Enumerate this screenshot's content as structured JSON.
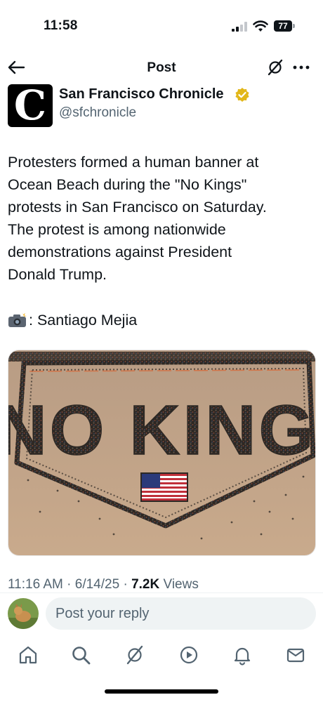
{
  "status_bar": {
    "time": "11:58",
    "battery": "77"
  },
  "header": {
    "title": "Post"
  },
  "author": {
    "logo_letter": "C",
    "name": "San Francisco Chronicle",
    "handle": "@sfchronicle",
    "verified_color": "#e2b719"
  },
  "post": {
    "text": "Protesters formed a human banner at\nOcean Beach during the \"No Kings\"\nprotests in San Francisco on Saturday.\nThe protest is among nationwide\ndemonstrations against President\nDonald Trump.",
    "credit_icon": "camera-flash-icon",
    "credit": ": Santiago Mejia",
    "image": {
      "sign_text": "NO KING!",
      "description_colors": {
        "sand": "#c4a58a",
        "crowd": "#2a2622",
        "flag_red": "#c0303a",
        "flag_blue": "#2b3a7a"
      }
    },
    "time": "11:16 AM",
    "date": "6/14/25",
    "views_count": "7.2K",
    "views_label": "Views"
  },
  "reply": {
    "placeholder": "Post your reply"
  },
  "nav": [
    "home-icon",
    "search-icon",
    "grok-icon",
    "video-icon",
    "notifications-icon",
    "messages-icon"
  ],
  "accent": "#0f1419",
  "secondary_text": "#536471"
}
